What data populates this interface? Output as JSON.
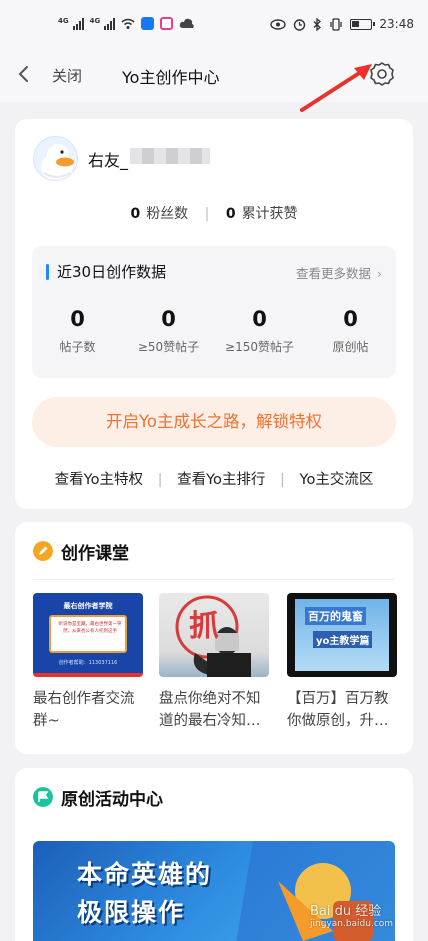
{
  "status_bar": {
    "network_left_1": "4G",
    "network_left_2": "4G",
    "time": "23:48",
    "icons_left": [
      "signal-icon",
      "signal-icon",
      "wifi-icon",
      "app-badge-blue-icon",
      "app-badge-pink-icon",
      "cloud-icon"
    ],
    "icons_right": [
      "eye-icon",
      "alarm-icon",
      "bluetooth-icon",
      "vibrate-icon",
      "battery-icon"
    ]
  },
  "nav": {
    "close_label": "关闭",
    "title": "Yo主创作中心",
    "icons": [
      "back-icon",
      "settings-icon"
    ]
  },
  "profile": {
    "name_prefix": "右友_",
    "fans_count": "0",
    "fans_label": "粉丝数",
    "likes_count": "0",
    "likes_label": "累计获赞"
  },
  "data_panel": {
    "title": "近30日创作数据",
    "more_label": "查看更多数据",
    "metrics": [
      {
        "value": "0",
        "label": "帖子数"
      },
      {
        "value": "0",
        "label": "≥50赞帖子"
      },
      {
        "value": "0",
        "label": "≥150赞帖子"
      },
      {
        "value": "0",
        "label": "原创帖"
      }
    ]
  },
  "cta": {
    "label": "开启Yo主成长之路，解锁特权"
  },
  "links": [
    "查看Yo主特权",
    "查看Yo主排行",
    "Yo主交流区"
  ],
  "classroom": {
    "title": "创作课堂",
    "items": [
      {
        "caption_line1": "最右创作者交流",
        "caption_line2": "群~",
        "thumb_heading": "最右创作者学院",
        "thumb_body": "听说你是宝藏，最右世界第一突然，从来也公有人托到这手",
        "thumb_footer": "创作者帮助：113037116"
      },
      {
        "caption_line1": "盘点你绝对不知",
        "caption_line2": "道的最右冷知…",
        "thumb_char": "抓"
      },
      {
        "caption_line1": "【百万】百万教",
        "caption_line2": "你做原创，升…",
        "thumb_line1": "百万的鬼畜",
        "thumb_line2": "yo主教学篇"
      }
    ]
  },
  "activity": {
    "title": "原创活动中心",
    "banner_line1": "本命英雄的",
    "banner_line2": "极限操作"
  },
  "watermark": {
    "line1": "Bai du 经验",
    "line2": "jingyan.baidu.com"
  },
  "colors": {
    "accent_blue": "#1e88ff",
    "cta_text": "#f07333",
    "cta_bg": "#fdeee6",
    "class_icon": "#f5a623",
    "activity_icon": "#19c39c",
    "annotation_arrow": "#e8322b"
  }
}
